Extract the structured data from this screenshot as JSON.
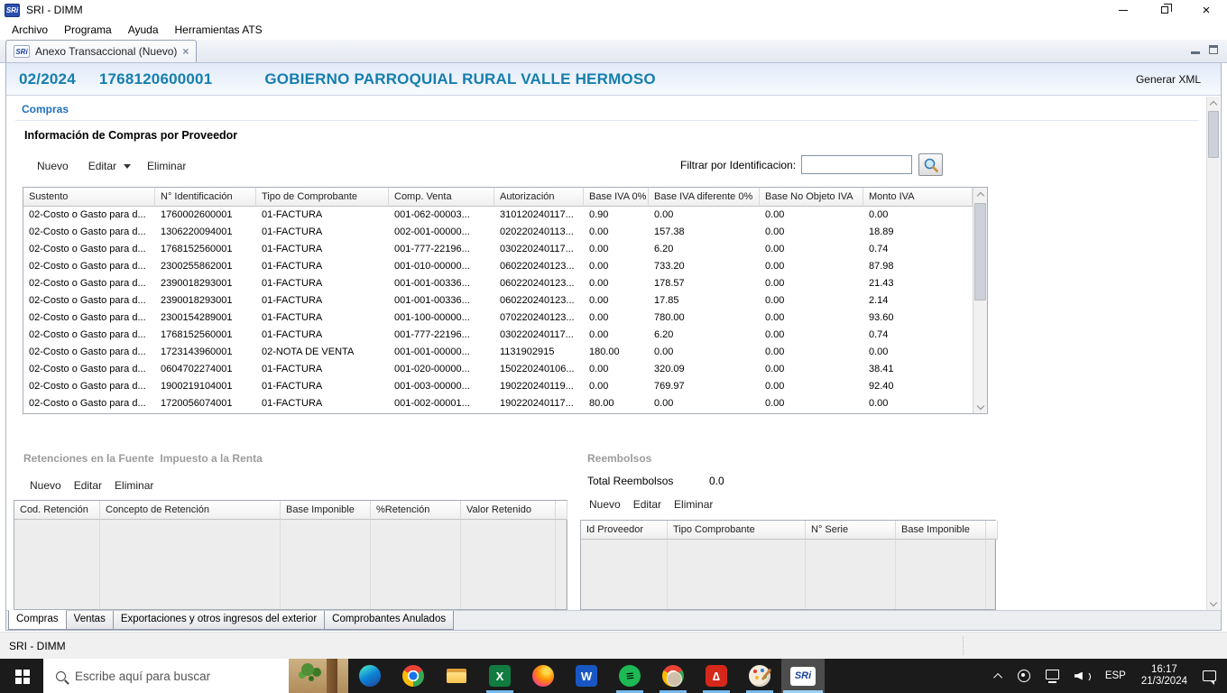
{
  "window": {
    "icon_text": "SRi",
    "title": "SRI - DIMM",
    "menu_items": [
      "Archivo",
      "Programa",
      "Ayuda",
      "Herramientas ATS"
    ],
    "tab_label": "Anexo Transaccional (Nuevo)",
    "tab_close": "×"
  },
  "header": {
    "period": "02/2024",
    "ruc": "1768120600001",
    "taxpayer": "GOBIERNO PARROQUIAL RURAL VALLE HERMOSO",
    "action": "Generar XML",
    "accent_color": "#157eae"
  },
  "compras": {
    "section_title": "Compras",
    "panel_title": "Información de Compras por Proveedor",
    "toolbar": [
      "Nuevo",
      "Editar",
      "Eliminar"
    ],
    "filter_label": "Filtrar por Identificacion:",
    "filter_value": "",
    "table": {
      "columns": [
        "Sustento",
        "N° Identificación",
        "Tipo de Comprobante",
        "Comp. Venta",
        "Autorización",
        "Base IVA 0%",
        "Base IVA diferente 0%",
        "Base No Objeto IVA",
        "Monto IVA"
      ],
      "rows": [
        [
          "02-Costo o Gasto para d...",
          "1760002600001",
          "01-FACTURA",
          "001-062-00003...",
          "310120240117...",
          "0.90",
          "0.00",
          "0.00",
          "0.00"
        ],
        [
          "02-Costo o Gasto para d...",
          "1306220094001",
          "01-FACTURA",
          "002-001-00000...",
          "020220240113...",
          "0.00",
          "157.38",
          "0.00",
          "18.89"
        ],
        [
          "02-Costo o Gasto para d...",
          "1768152560001",
          "01-FACTURA",
          "001-777-22196...",
          "030220240117...",
          "0.00",
          "6.20",
          "0.00",
          "0.74"
        ],
        [
          "02-Costo o Gasto para d...",
          "2300255862001",
          "01-FACTURA",
          "001-010-00000...",
          "060220240123...",
          "0.00",
          "733.20",
          "0.00",
          "87.98"
        ],
        [
          "02-Costo o Gasto para d...",
          "2390018293001",
          "01-FACTURA",
          "001-001-00336...",
          "060220240123...",
          "0.00",
          "178.57",
          "0.00",
          "21.43"
        ],
        [
          "02-Costo o Gasto para d...",
          "2390018293001",
          "01-FACTURA",
          "001-001-00336...",
          "060220240123...",
          "0.00",
          "17.85",
          "0.00",
          "2.14"
        ],
        [
          "02-Costo o Gasto para d...",
          "2300154289001",
          "01-FACTURA",
          "001-100-00000...",
          "070220240123...",
          "0.00",
          "780.00",
          "0.00",
          "93.60"
        ],
        [
          "02-Costo o Gasto para d...",
          "1768152560001",
          "01-FACTURA",
          "001-777-22196...",
          "030220240117...",
          "0.00",
          "6.20",
          "0.00",
          "0.74"
        ],
        [
          "02-Costo o Gasto para d...",
          "1723143960001",
          "02-NOTA DE VENTA",
          "001-001-00000...",
          "1131902915",
          "180.00",
          "0.00",
          "0.00",
          "0.00"
        ],
        [
          "02-Costo o Gasto para d...",
          "0604702274001",
          "01-FACTURA",
          "001-020-00000...",
          "150220240106...",
          "0.00",
          "320.09",
          "0.00",
          "38.41"
        ],
        [
          "02-Costo o Gasto para d...",
          "1900219104001",
          "01-FACTURA",
          "001-003-00000...",
          "190220240119...",
          "0.00",
          "769.97",
          "0.00",
          "92.40"
        ],
        [
          "02-Costo o Gasto para d...",
          "1720056074001",
          "01-FACTURA",
          "001-002-00001...",
          "190220240117...",
          "80.00",
          "0.00",
          "0.00",
          "0.00"
        ]
      ]
    }
  },
  "retenciones": {
    "title_a": "Retenciones en la Fuente",
    "title_b": "Impuesto a la Renta",
    "toolbar": [
      "Nuevo",
      "Editar",
      "Eliminar"
    ],
    "columns": [
      "Cod. Retención",
      "Concepto de Retención",
      "Base Imponible",
      "%Retención",
      "Valor Retenido"
    ]
  },
  "reembolsos": {
    "title": "Reembolsos",
    "total_label": "Total Reembolsos",
    "total_value": "0.0",
    "toolbar": [
      "Nuevo",
      "Editar",
      "Eliminar"
    ],
    "columns": [
      "Id Proveedor",
      "Tipo Comprobante",
      "N° Serie",
      "Base Imponible"
    ]
  },
  "bottom_tabs": [
    "Compras",
    "Ventas",
    "Exportaciones y otros ingresos del exterior",
    "Comprobantes Anulados"
  ],
  "status_bar": "SRI - DIMM",
  "taskbar": {
    "search_placeholder": "Escribe aquí para buscar",
    "apps": [
      {
        "name": "edge",
        "running": false
      },
      {
        "name": "chrome",
        "running": false
      },
      {
        "name": "file-explorer",
        "running": false
      },
      {
        "name": "excel",
        "running": true,
        "text": "X"
      },
      {
        "name": "firefox",
        "running": false
      },
      {
        "name": "word",
        "running": false,
        "text": "W"
      },
      {
        "name": "spotify",
        "running": true,
        "text": "≡"
      },
      {
        "name": "chrome-alt",
        "running": true
      },
      {
        "name": "acrobat",
        "running": true,
        "text": "∆"
      },
      {
        "name": "paint",
        "running": true
      },
      {
        "name": "sri-dimm",
        "running": true,
        "active": true,
        "text": "SRi"
      }
    ],
    "tray": {
      "language": "ESP",
      "time": "16:17",
      "date": "21/3/2024"
    }
  }
}
